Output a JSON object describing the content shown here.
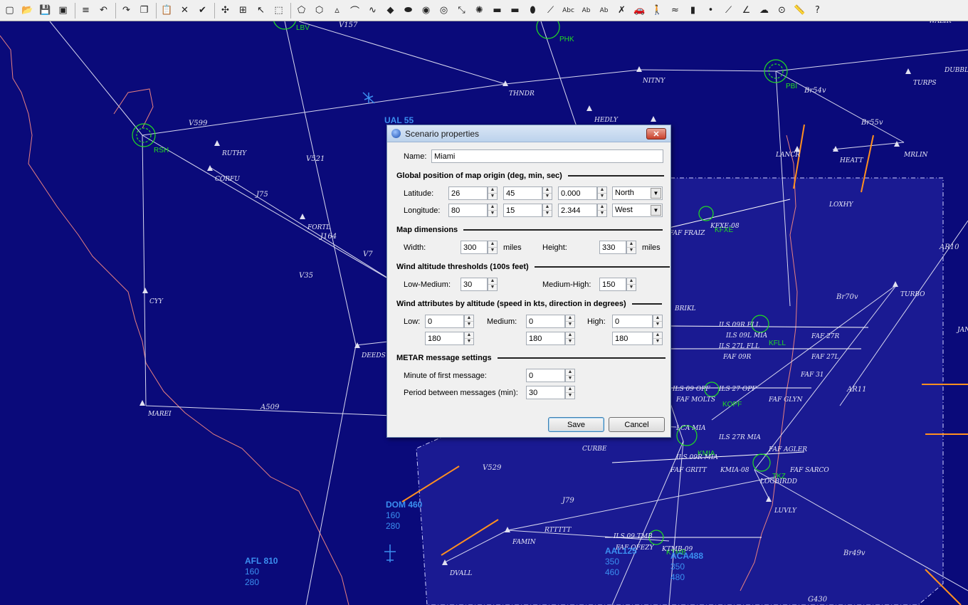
{
  "toolbar": {
    "icons": [
      "new-file-icon",
      "open-folder-icon",
      "save-icon",
      "properties-icon",
      "import-icon",
      "undo-icon",
      "redo-icon",
      "copy-icon",
      "paste-icon",
      "delete-icon",
      "check-icon",
      "map-icon",
      "tree-icon",
      "pointer-icon",
      "select-area-icon",
      "polygon-icon",
      "polygon-alt-icon",
      "triangle-icon",
      "line-icon",
      "curve-icon",
      "fill-icon",
      "ellipse-icon",
      "circle-icon",
      "target-icon",
      "link-icon",
      "radar-icon",
      "runway-icon",
      "area-icon",
      "oval-icon",
      "route-icon",
      "text-icon",
      "label-icon",
      "label-alt-icon",
      "cross-icon",
      "car-icon",
      "person-icon",
      "wave-icon",
      "tower-icon",
      "dot-icon",
      "diagonal-icon",
      "angle-icon",
      "cloud-icon",
      "stop-icon",
      "ruler-icon",
      "help-icon"
    ],
    "glyphs": [
      "▢",
      "📂",
      "💾",
      "▣",
      "≡",
      "↶",
      "↷",
      "❐",
      "📋",
      "✕",
      "✔",
      "✣",
      "⊞",
      "↖",
      "⬚",
      "⬠",
      "⬡",
      "▵",
      "⌒",
      "∿",
      "◆",
      "⬬",
      "◉",
      "◎",
      "⤡",
      "✺",
      "▬",
      "▬",
      "⬮",
      "⟋",
      "Abc",
      "Ab",
      "Ab",
      "✗",
      "🚗",
      "🚶",
      "≈",
      "▮",
      "•",
      "⟋",
      "∠",
      "☁",
      "⊙",
      "📏",
      "?"
    ]
  },
  "dialog": {
    "title": "Scenario properties",
    "close": "✕",
    "name_label": "Name:",
    "name_value": "Miami",
    "origin_section": "Global position of map origin (deg, min, sec)",
    "latitude_label": "Latitude:",
    "latitude": {
      "deg": "26",
      "min": "45",
      "sec": "0.000",
      "hemisphere": "North"
    },
    "longitude_label": "Longitude:",
    "longitude": {
      "deg": "80",
      "min": "15",
      "sec": "2.344",
      "hemisphere": "West"
    },
    "dims_section": "Map dimensions",
    "width_label": "Width:",
    "width_value": "300",
    "width_unit": "miles",
    "height_label": "Height:",
    "height_value": "330",
    "height_unit": "miles",
    "wind_thr_section": "Wind altitude thresholds (100s feet)",
    "low_medium_label": "Low-Medium:",
    "low_medium_value": "30",
    "medium_high_label": "Medium-High:",
    "medium_high_value": "150",
    "wind_attr_section": "Wind attributes by altitude (speed in kts, direction in degrees)",
    "low_label": "Low:",
    "low_speed": "0",
    "low_dir": "180",
    "medium_label": "Medium:",
    "medium_speed": "0",
    "medium_dir": "180",
    "high_label": "High:",
    "high_speed": "0",
    "high_dir": "180",
    "metar_section": "METAR message settings",
    "first_msg_label": "Minute of first message:",
    "first_msg_value": "0",
    "period_label": "Period between messages (min):",
    "period_value": "30",
    "save": "Save",
    "cancel": "Cancel"
  },
  "aircraft": [
    {
      "callsign": "UAL 55",
      "l1": "",
      "l2": ""
    },
    {
      "callsign": "DOM 460",
      "l1": "160",
      "l2": "280"
    },
    {
      "callsign": "AFL 810",
      "l1": "160",
      "l2": "280"
    },
    {
      "callsign": "AAL125",
      "l1": "350",
      "l2": "460"
    },
    {
      "callsign": "ACA488",
      "l1": "350",
      "l2": "480"
    }
  ],
  "waypoints": [
    "THNDR",
    "NITNY",
    "HEDLY",
    "TURPS",
    "DUBBL",
    "LANCR",
    "HEATT",
    "MRLIN",
    "RUTHY",
    "CORFU",
    "FORTL",
    "CYY",
    "DEEDS",
    "MAREI",
    "BRIKL",
    "TURBO",
    "FAF 27R",
    "FAF 27L",
    "FAF 31",
    "FAF 09R",
    "FAF GLYN",
    "CURBE",
    "FAF AGLER",
    "FAF SARCO",
    "FAF GRITT",
    "LUVLY",
    "RTTTTT",
    "FAMIN",
    "DVALL",
    "FAF QFEZY",
    "LOXHY",
    "FAF FRAIZ",
    "FAF MOLTS",
    "LOGBIRDD",
    "JAN",
    "WALIR"
  ],
  "airports": [
    "LBV",
    "PHK",
    "PBI",
    "RSH",
    "KFXE",
    "KOPF",
    "KMIA",
    "KTMB",
    "TKZ",
    "KFLL"
  ],
  "routes": [
    "V157",
    "V599",
    "V521",
    "J75",
    "V7",
    "V35",
    "A509",
    "V529",
    "J79",
    "Br54v",
    "Br55v",
    "Br70v",
    "AR10",
    "AR11",
    "Br49v",
    "G430",
    "J164",
    "ILS 09R FLL",
    "ILS 27L FLL",
    "ILS 09 OPF",
    "ILS 27 OPF",
    "ILS 27R MIA",
    "ILS 09R MIA",
    "ILS 09L MIA",
    "LCA MIA",
    "ILS 09 TMB",
    "KFXE-08",
    "KTMB-09",
    "KMIA-08"
  ]
}
